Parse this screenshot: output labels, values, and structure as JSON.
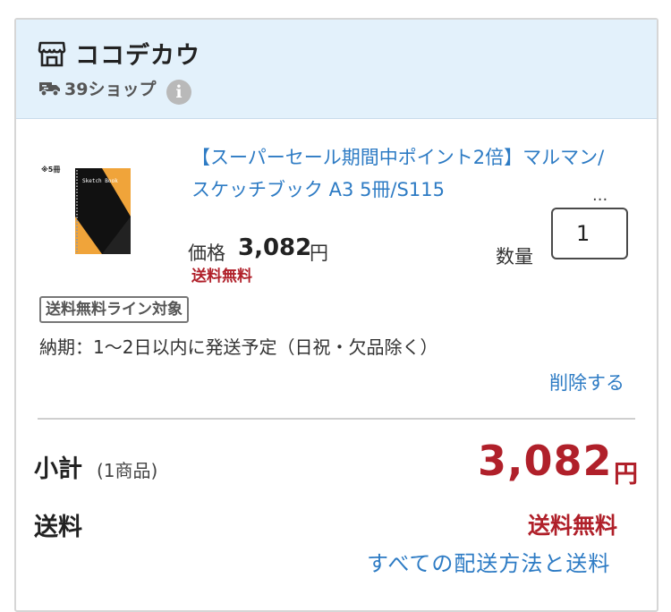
{
  "shop": {
    "name": "ココデカウ",
    "shipping_label": "39ショップ",
    "info_glyph": "i"
  },
  "item": {
    "title": "【スーパーセール期間中ポイント2倍】マルマン/スケッチブック A3 5冊/S115",
    "ellipsis": "...",
    "thumb_label": "※5冊",
    "thumb_cover_text": "Sketch Book",
    "price_label": "価格",
    "price_value": "3,082",
    "price_unit": "円",
    "qty_label": "数量",
    "qty_value": "1",
    "free_shipping": "送料無料",
    "free_line_badge": "送料無料ライン対象",
    "delivery": "納期：1〜2日以内に発送予定（日祝・欠品除く）",
    "delete": "削除する"
  },
  "summary": {
    "subtotal_label": "小計",
    "subtotal_count": "(1商品)",
    "subtotal_value": "3,082",
    "subtotal_unit": "円",
    "shipping_label": "送料",
    "shipping_value": "送料無料",
    "shipping_methods_link": "すべての配送方法と送料"
  },
  "colors": {
    "header_bg": "#e3f1fb",
    "link": "#2d7bc4",
    "accent_red": "#b0202a",
    "cover_orange": "#f0a43a"
  },
  "icons": {
    "shop": "storefront-icon",
    "truck": "truck-icon",
    "info": "info-icon"
  }
}
